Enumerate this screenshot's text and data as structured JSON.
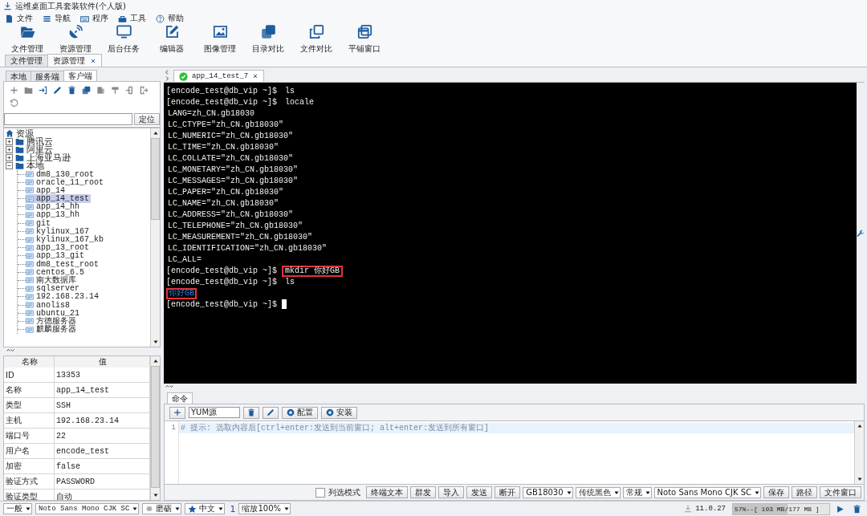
{
  "window": {
    "title": "运维桌面工具套装软件(个人版)"
  },
  "menu": [
    {
      "label": "文件"
    },
    {
      "label": "导航"
    },
    {
      "label": "程序"
    },
    {
      "label": "工具"
    },
    {
      "label": "帮助"
    }
  ],
  "toolbar": [
    {
      "label": "文件管理"
    },
    {
      "label": "资源管理"
    },
    {
      "label": "后台任务"
    },
    {
      "label": "编辑器"
    },
    {
      "label": "图像管理"
    },
    {
      "label": "目录对比"
    },
    {
      "label": "文件对比"
    },
    {
      "label": "平铺窗口"
    }
  ],
  "main_tabs": [
    {
      "label": "文件管理",
      "selected": false,
      "closable": false
    },
    {
      "label": "资源管理",
      "selected": true,
      "closable": true
    }
  ],
  "resource_panel": {
    "tabs": [
      {
        "label": "本地",
        "selected": false
      },
      {
        "label": "服务端",
        "selected": false
      },
      {
        "label": "客户端",
        "selected": true
      }
    ],
    "locate_button": "定位",
    "tree": {
      "label": "资源",
      "selected": false,
      "children": [
        {
          "label": "腾讯云",
          "expanded": false,
          "selected": false
        },
        {
          "label": "阿里云",
          "expanded": false,
          "selected": false
        },
        {
          "label": "上海亚马逊",
          "expanded": false,
          "selected": false
        },
        {
          "label": "本地",
          "expanded": true,
          "selected": false,
          "children": [
            {
              "label": "dm8_130_root",
              "selected": false
            },
            {
              "label": "oracle_11_root",
              "selected": false
            },
            {
              "label": "app_14",
              "selected": false
            },
            {
              "label": "app_14_test",
              "selected": true
            },
            {
              "label": "app_14_hh",
              "selected": false
            },
            {
              "label": "app_13_hh",
              "selected": false
            },
            {
              "label": "git",
              "selected": false
            },
            {
              "label": "kylinux_167",
              "selected": false
            },
            {
              "label": "kylinux_167_kb",
              "selected": false
            },
            {
              "label": "app_13_root",
              "selected": false
            },
            {
              "label": "app_13_git",
              "selected": false
            },
            {
              "label": "dm8_test_root",
              "selected": false
            },
            {
              "label": "centos_6.5",
              "selected": false
            },
            {
              "label": "南大数据库",
              "selected": false
            },
            {
              "label": "sqlserver",
              "selected": false
            },
            {
              "label": "192.168.23.14",
              "selected": false
            },
            {
              "label": "anolis8",
              "selected": false
            },
            {
              "label": "ubuntu_21",
              "selected": false
            },
            {
              "label": "方德服务器",
              "selected": false
            },
            {
              "label": "麒麟服务器",
              "selected": false
            }
          ]
        }
      ]
    }
  },
  "properties": {
    "columns": [
      "名称",
      "值"
    ],
    "rows": [
      [
        "ID",
        "13353"
      ],
      [
        "名称",
        "app_14_test"
      ],
      [
        "类型",
        "SSH"
      ],
      [
        "主机",
        "192.168.23.14"
      ],
      [
        "端口号",
        "22"
      ],
      [
        "用户名",
        "encode_test"
      ],
      [
        "加密",
        "false"
      ],
      [
        "验证方式",
        "PASSWORD"
      ],
      [
        "验证类型",
        "自动"
      ]
    ]
  },
  "session_tabs": [
    {
      "label": "app_14_test_7",
      "connected": true,
      "selected": true
    }
  ],
  "terminal": {
    "lines": [
      {
        "kind": "prompt",
        "prompt": "[encode_test@db_vip ~]$",
        "command": "ls",
        "highlighted": false
      },
      {
        "kind": "prompt",
        "prompt": "[encode_test@db_vip ~]$",
        "command": "locale",
        "highlighted": false
      },
      {
        "kind": "output",
        "text": "LANG=zh_CN.gb18030",
        "highlighted": false
      },
      {
        "kind": "output",
        "text": "LC_CTYPE=\"zh_CN.gb18030\"",
        "highlighted": false
      },
      {
        "kind": "output",
        "text": "LC_NUMERIC=\"zh_CN.gb18030\"",
        "highlighted": false
      },
      {
        "kind": "output",
        "text": "LC_TIME=\"zh_CN.gb18030\"",
        "highlighted": false
      },
      {
        "kind": "output",
        "text": "LC_COLLATE=\"zh_CN.gb18030\"",
        "highlighted": false
      },
      {
        "kind": "output",
        "text": "LC_MONETARY=\"zh_CN.gb18030\"",
        "highlighted": false
      },
      {
        "kind": "output",
        "text": "LC_MESSAGES=\"zh_CN.gb18030\"",
        "highlighted": false
      },
      {
        "kind": "output",
        "text": "LC_PAPER=\"zh_CN.gb18030\"",
        "highlighted": false
      },
      {
        "kind": "output",
        "text": "LC_NAME=\"zh_CN.gb18030\"",
        "highlighted": false
      },
      {
        "kind": "output",
        "text": "LC_ADDRESS=\"zh_CN.gb18030\"",
        "highlighted": false
      },
      {
        "kind": "output",
        "text": "LC_TELEPHONE=\"zh_CN.gb18030\"",
        "highlighted": false
      },
      {
        "kind": "output",
        "text": "LC_MEASUREMENT=\"zh_CN.gb18030\"",
        "highlighted": false
      },
      {
        "kind": "output",
        "text": "LC_IDENTIFICATION=\"zh_CN.gb18030\"",
        "highlighted": false
      },
      {
        "kind": "output",
        "text": "LC_ALL=",
        "highlighted": false
      },
      {
        "kind": "prompt",
        "prompt": "[encode_test@db_vip ~]$",
        "command": "mkdir 你好GB",
        "highlighted": true
      },
      {
        "kind": "prompt",
        "prompt": "[encode_test@db_vip ~]$",
        "command": "ls",
        "highlighted": false
      },
      {
        "kind": "dir",
        "text": "你好GB",
        "highlighted": true
      },
      {
        "kind": "input",
        "prompt": "[encode_test@db_vip ~]$",
        "highlighted": false
      }
    ]
  },
  "command_panel": {
    "tabs": [
      {
        "label": "命令",
        "selected": true
      }
    ],
    "preset": "YUM源",
    "actions": [
      "配置",
      "安装"
    ],
    "editor": [
      {
        "number": "1",
        "text": "# 提示: 选取内容后[ctrl+enter:发送到当前窗口; alt+enter:发送到所有窗口]"
      }
    ],
    "column_mode": {
      "label": "列选模式",
      "checked": false
    },
    "buttons": [
      "终端文本",
      "群发",
      "导入",
      "发送",
      "断开"
    ],
    "selects": [
      "GB18030",
      "传统黑色",
      "常规",
      "Noto Sans Mono CJK SC"
    ],
    "buttons_right": [
      "保存",
      "路径",
      "文件窗口"
    ]
  },
  "status_bar": {
    "style": "一般",
    "font": "Noto Sans Mono CJK SC",
    "theme": "磨砺",
    "language": "中文",
    "zoom_step": "1",
    "zoom": "缩放100%",
    "version": "11.0.27",
    "memory": {
      "text": "57%--[ 103 MB/177 MB ]",
      "level": 0.57
    }
  }
}
